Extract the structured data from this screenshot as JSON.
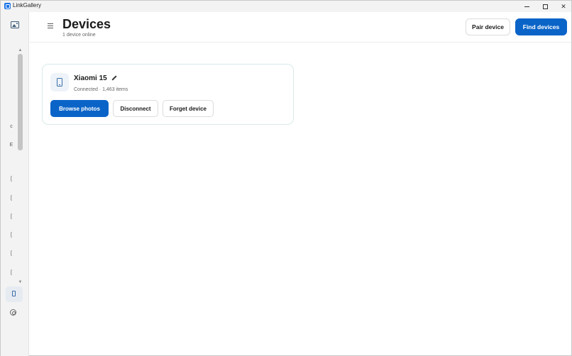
{
  "window": {
    "app_title": "LinkGallery",
    "controls": {
      "minimize": "minimize",
      "maximize": "maximize",
      "close": "✕"
    }
  },
  "rail": {
    "glyphs": [
      "c",
      "E",
      "[",
      "[",
      "[",
      "[",
      "[",
      "["
    ],
    "icons": [
      "gallery-icon",
      "phone-icon",
      "gear-icon"
    ]
  },
  "header": {
    "title": "Devices",
    "subtitle": "1 device online",
    "pair_label": "Pair device",
    "find_label": "Find devices"
  },
  "device": {
    "name": "Xiaomi 15",
    "status": "Connected · 1,463 items",
    "browse_label": "Browse photos",
    "disconnect_label": "Disconnect",
    "forget_label": "Forget device"
  },
  "colors": {
    "accent": "#0a64c8",
    "card_border": "#d9eaea",
    "rail_bg": "#f3f3f3"
  }
}
